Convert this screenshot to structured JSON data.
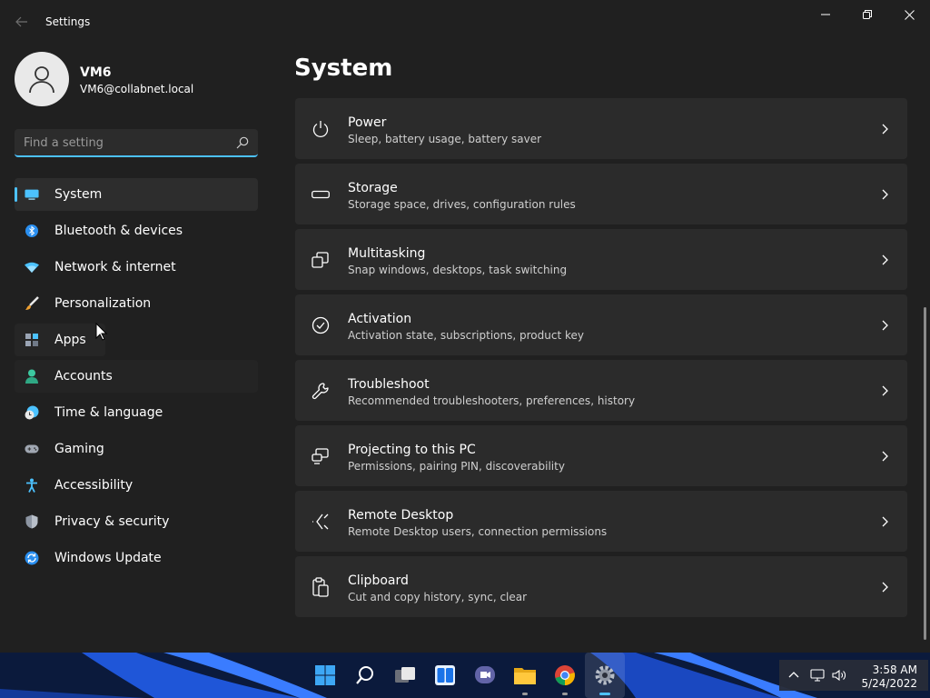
{
  "window": {
    "title": "Settings"
  },
  "profile": {
    "name": "VM6",
    "email": "VM6@collabnet.local"
  },
  "search": {
    "placeholder": "Find a setting",
    "value": ""
  },
  "sidebar": {
    "items": [
      {
        "label": "System",
        "icon": "system-monitor-icon",
        "selected": true
      },
      {
        "label": "Bluetooth & devices",
        "icon": "bluetooth-icon"
      },
      {
        "label": "Network & internet",
        "icon": "wifi-icon"
      },
      {
        "label": "Personalization",
        "icon": "paintbrush-icon"
      },
      {
        "label": "Apps",
        "icon": "apps-icon"
      },
      {
        "label": "Accounts",
        "icon": "accounts-person-icon"
      },
      {
        "label": "Time & language",
        "icon": "clock-globe-icon"
      },
      {
        "label": "Gaming",
        "icon": "gamepad-icon"
      },
      {
        "label": "Accessibility",
        "icon": "accessibility-icon"
      },
      {
        "label": "Privacy & security",
        "icon": "shield-icon"
      },
      {
        "label": "Windows Update",
        "icon": "update-icon"
      }
    ]
  },
  "main": {
    "title": "System",
    "cards": [
      {
        "title": "Power",
        "subtitle": "Sleep, battery usage, battery saver",
        "icon": "power-icon"
      },
      {
        "title": "Storage",
        "subtitle": "Storage space, drives, configuration rules",
        "icon": "storage-drive-icon"
      },
      {
        "title": "Multitasking",
        "subtitle": "Snap windows, desktops, task switching",
        "icon": "multitasking-icon"
      },
      {
        "title": "Activation",
        "subtitle": "Activation state, subscriptions, product key",
        "icon": "activation-check-icon"
      },
      {
        "title": "Troubleshoot",
        "subtitle": "Recommended troubleshooters, preferences, history",
        "icon": "wrench-icon"
      },
      {
        "title": "Projecting to this PC",
        "subtitle": "Permissions, pairing PIN, discoverability",
        "icon": "projecting-icon"
      },
      {
        "title": "Remote Desktop",
        "subtitle": "Remote Desktop users, connection permissions",
        "icon": "remote-desktop-icon"
      },
      {
        "title": "Clipboard",
        "subtitle": "Cut and copy history, sync, clear",
        "icon": "clipboard-icon"
      }
    ]
  },
  "taskbar": {
    "apps": [
      "start-icon",
      "search-icon",
      "task-view-icon",
      "widgets-icon",
      "teams-chat-icon",
      "file-explorer-icon",
      "chrome-icon",
      "settings-gear-icon"
    ],
    "time": "3:58 AM",
    "date": "5/24/2022"
  },
  "colors": {
    "accent": "#4cc2ff",
    "background": "#202020",
    "card": "#2b2b2b"
  }
}
